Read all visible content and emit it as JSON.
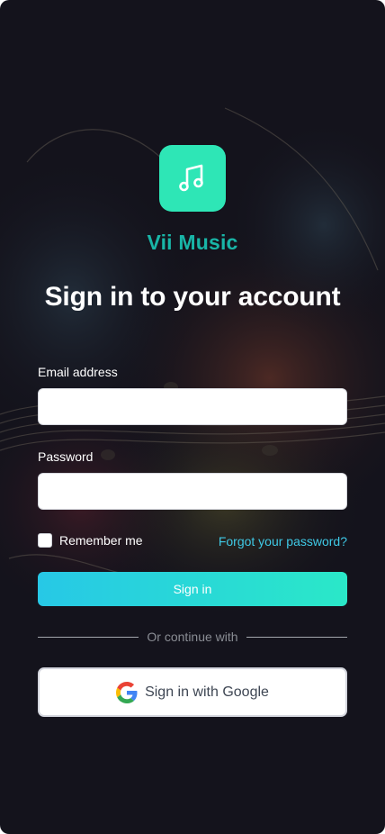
{
  "app": {
    "name": "Vii Music",
    "logo_icon": "music-note-icon",
    "brand_color": "#2ee6b6"
  },
  "page": {
    "title": "Sign in to your account"
  },
  "form": {
    "email_label": "Email address",
    "email_value": "",
    "password_label": "Password",
    "password_value": "",
    "remember_label": "Remember me",
    "remember_checked": false,
    "forgot_label": "Forgot your password?",
    "submit_label": "Sign in"
  },
  "divider": {
    "text": "Or continue with"
  },
  "social": {
    "google_label": "Sign in with Google",
    "google_icon": "google-icon"
  },
  "colors": {
    "background": "#14131c",
    "app_name": "#19b5a7",
    "link": "#3fc9e6",
    "button_gradient_start": "#27c8e6",
    "button_gradient_end": "#2ae8c8"
  }
}
